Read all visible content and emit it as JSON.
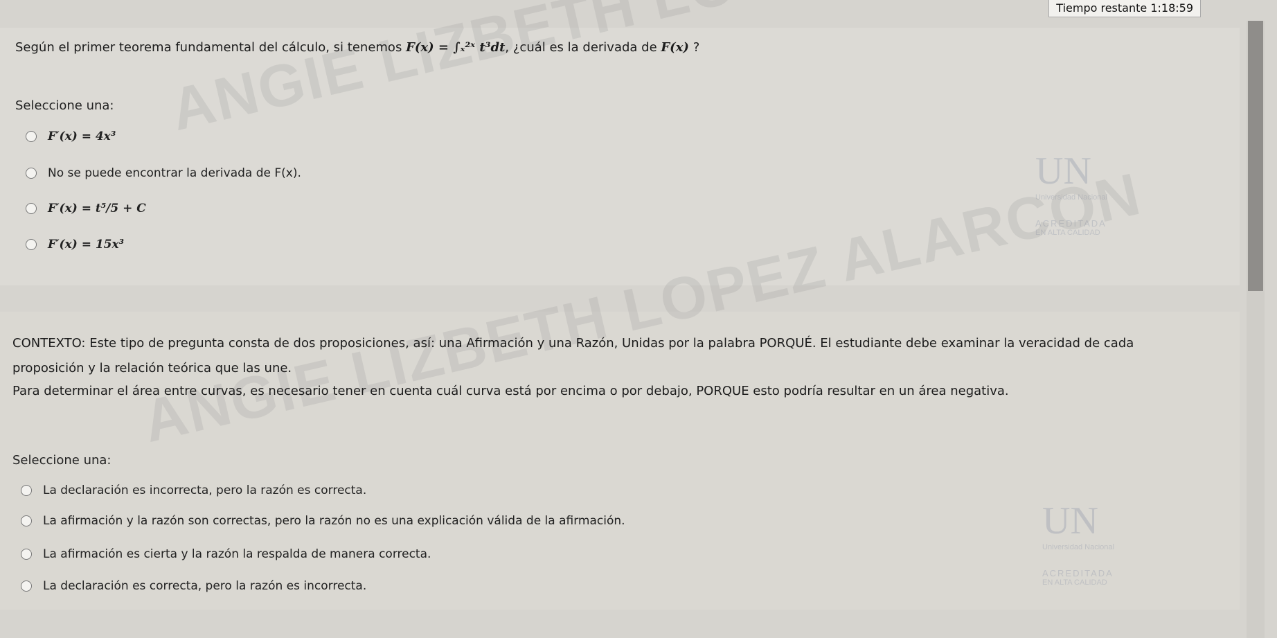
{
  "timer": {
    "label": "Tiempo restante",
    "value": "1:18:59"
  },
  "question1": {
    "prompt_start": "Según el primer teorema fundamental del cálculo, si tenemos",
    "formula": "F(x) = ∫ₓ²ˣ t³dt",
    "prompt_middle": ", ¿cuál es la derivada de",
    "formula_end": "F(x)",
    "prompt_end": "?",
    "select_label": "Seleccione una:",
    "options": [
      {
        "label": "F′(x) = 4x³"
      },
      {
        "label": "No se puede encontrar la derivada de F(x)."
      },
      {
        "label": "F′(x) = t⁵/5 + C"
      },
      {
        "label": "F′(x) = 15x³"
      }
    ]
  },
  "question2": {
    "context": "CONTEXTO: Este tipo de pregunta consta de dos proposiciones, así: una Afirmación y una Razón, Unidas por la palabra PORQUÉ. El estudiante debe examinar la veracidad de cada proposición y la relación teórica que las une.",
    "statement": "Para determinar el área entre curvas, es necesario tener en cuenta cuál curva está por encima o por debajo, PORQUE esto podría resultar en un área negativa.",
    "select_label": "Seleccione una:",
    "options": [
      {
        "label": "La declaración es incorrecta, pero la razón es correcta."
      },
      {
        "label": "La afirmación y la razón son correctas, pero la razón no es una explicación válida de la afirmación."
      },
      {
        "label": "La afirmación es cierta y la razón la respalda de manera correcta."
      },
      {
        "label": "La declaración es correcta, pero la razón es incorrecta."
      }
    ]
  },
  "watermark": {
    "text": "ANGIE LIZBETH LOPEZ ALARCON"
  },
  "logo": {
    "mark": "UN",
    "name": "Universidad Nacional",
    "accreditation": "ACREDITADA",
    "accreditation_sub": "EN ALTA CALIDAD"
  }
}
